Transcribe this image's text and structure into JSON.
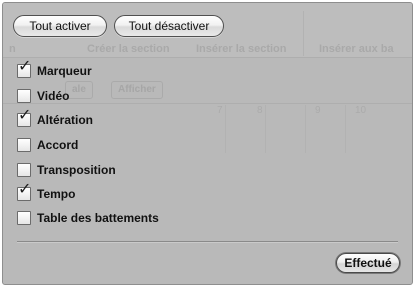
{
  "background_window": {
    "toolbar_labels": [
      "Créer la section",
      "Insérer la section"
    ],
    "toolbar_label_right": "Insérer aux ba",
    "toolbar_label_left": "n",
    "view_button": "Afficher",
    "left_pill": "ale",
    "ruler_numbers": [
      "7",
      "8",
      "9",
      "10"
    ]
  },
  "buttons": {
    "select_all": "Tout activer",
    "deselect_all": "Tout désactiver",
    "done": "Effectué"
  },
  "options": [
    {
      "label": "Marqueur",
      "checked": true
    },
    {
      "label": "Vidéo",
      "checked": false
    },
    {
      "label": "Altération",
      "checked": true
    },
    {
      "label": "Accord",
      "checked": false
    },
    {
      "label": "Transposition",
      "checked": false
    },
    {
      "label": "Tempo",
      "checked": true
    },
    {
      "label": "Table des battements",
      "checked": false
    }
  ],
  "check_glyph": "✓"
}
